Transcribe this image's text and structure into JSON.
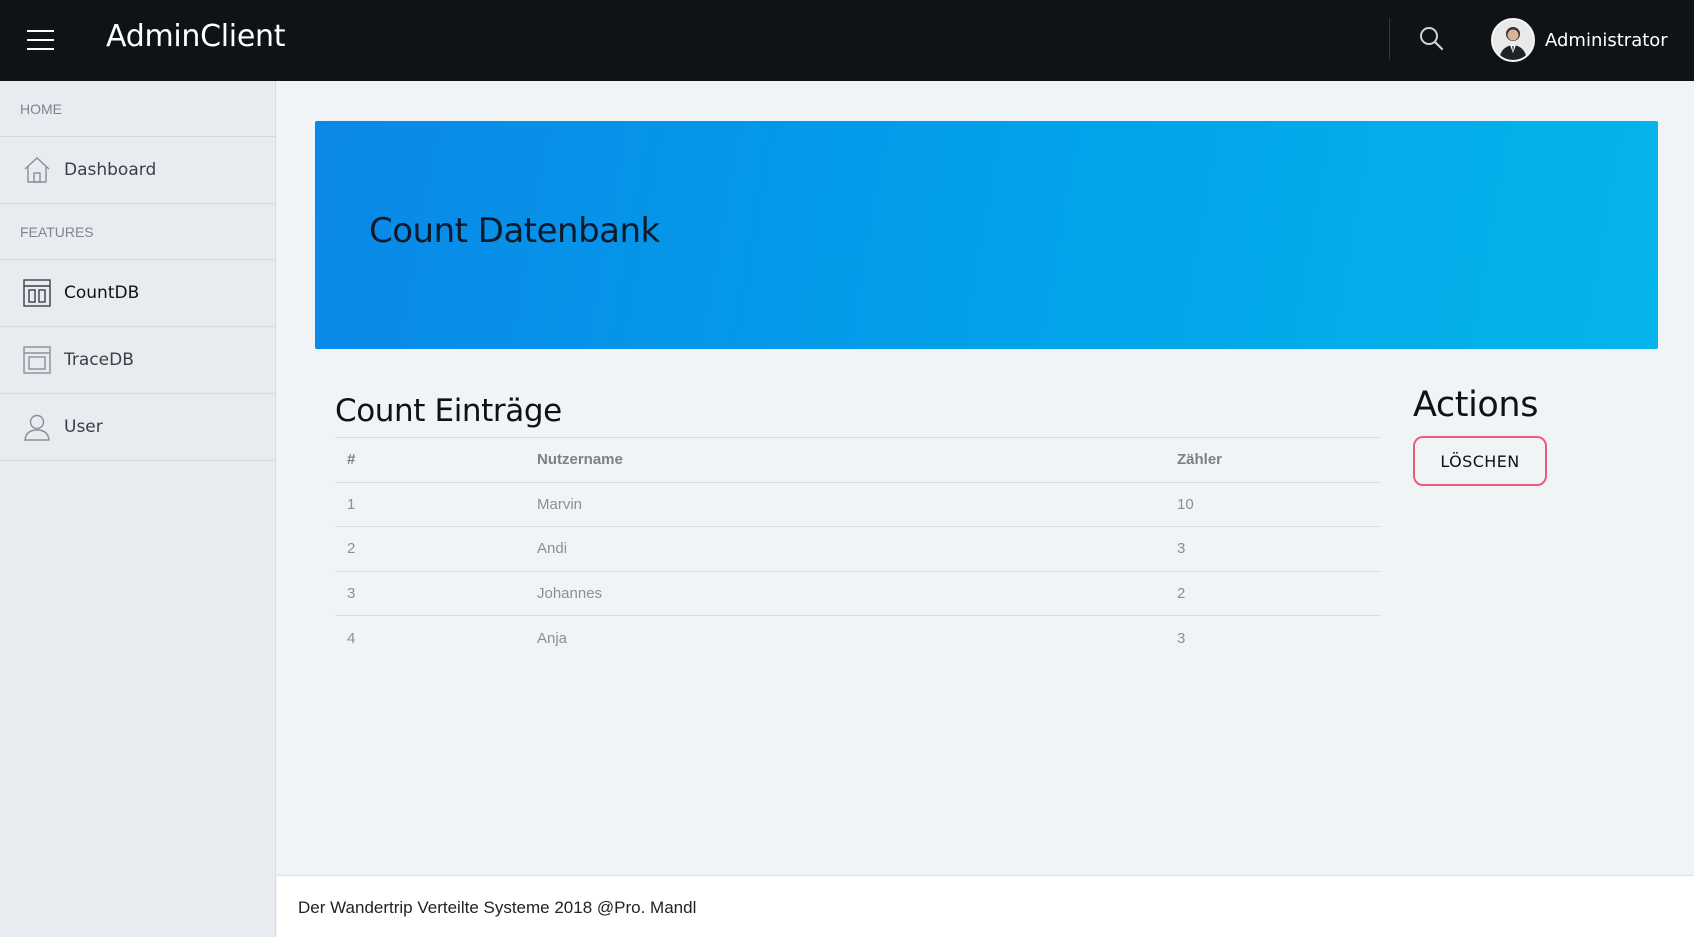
{
  "header": {
    "brand": "AdminClient",
    "user_name": "Administrator"
  },
  "sidebar": {
    "sections": [
      {
        "label": "HOME"
      },
      {
        "label": "FEATURES"
      }
    ],
    "items": [
      {
        "label": "Dashboard",
        "icon": "home-icon"
      },
      {
        "label": "CountDB",
        "icon": "columns-icon",
        "active": true
      },
      {
        "label": "TraceDB",
        "icon": "window-icon"
      },
      {
        "label": "User",
        "icon": "user-icon"
      }
    ]
  },
  "hero": {
    "title": "Count Datenbank"
  },
  "table": {
    "title": "Count Einträge",
    "columns": [
      "#",
      "Nutzername",
      "Zähler"
    ],
    "rows": [
      [
        "1",
        "Marvin",
        "10"
      ],
      [
        "2",
        "Andi",
        "3"
      ],
      [
        "3",
        "Johannes",
        "2"
      ],
      [
        "4",
        "Anja",
        "3"
      ]
    ]
  },
  "actions": {
    "title": "Actions",
    "delete_label": "LÖSCHEN"
  },
  "footer": {
    "text": "Der Wandertrip Verteilte Systeme 2018 @Pro. Mandl"
  },
  "colors": {
    "topbar": "#0f1217",
    "hero_start": "#0a88e8",
    "hero_end": "#04b5ea",
    "delete_border": "#ef5a7b"
  }
}
